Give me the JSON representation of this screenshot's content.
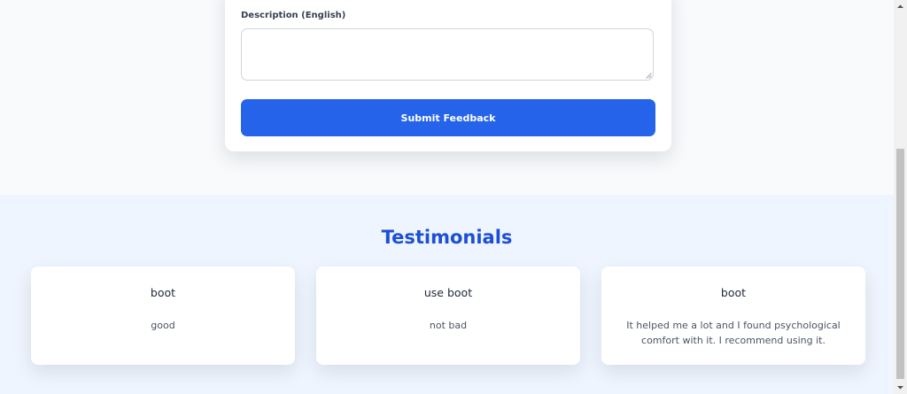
{
  "feedback_form": {
    "description_label": "Description (English)",
    "description_value": "",
    "submit_label": "Submit Feedback"
  },
  "testimonials": {
    "title": "Testimonials",
    "items": [
      {
        "name": "boot",
        "text": "good"
      },
      {
        "name": "use boot",
        "text": "not bad"
      },
      {
        "name": "boot",
        "text": "It helped me a lot and I found psychological comfort with it. I recommend using it."
      }
    ]
  },
  "colors": {
    "primary": "#2563eb",
    "title": "#1d4ed8",
    "section_bg": "#eef5fe",
    "page_bg": "#f8fafc"
  }
}
